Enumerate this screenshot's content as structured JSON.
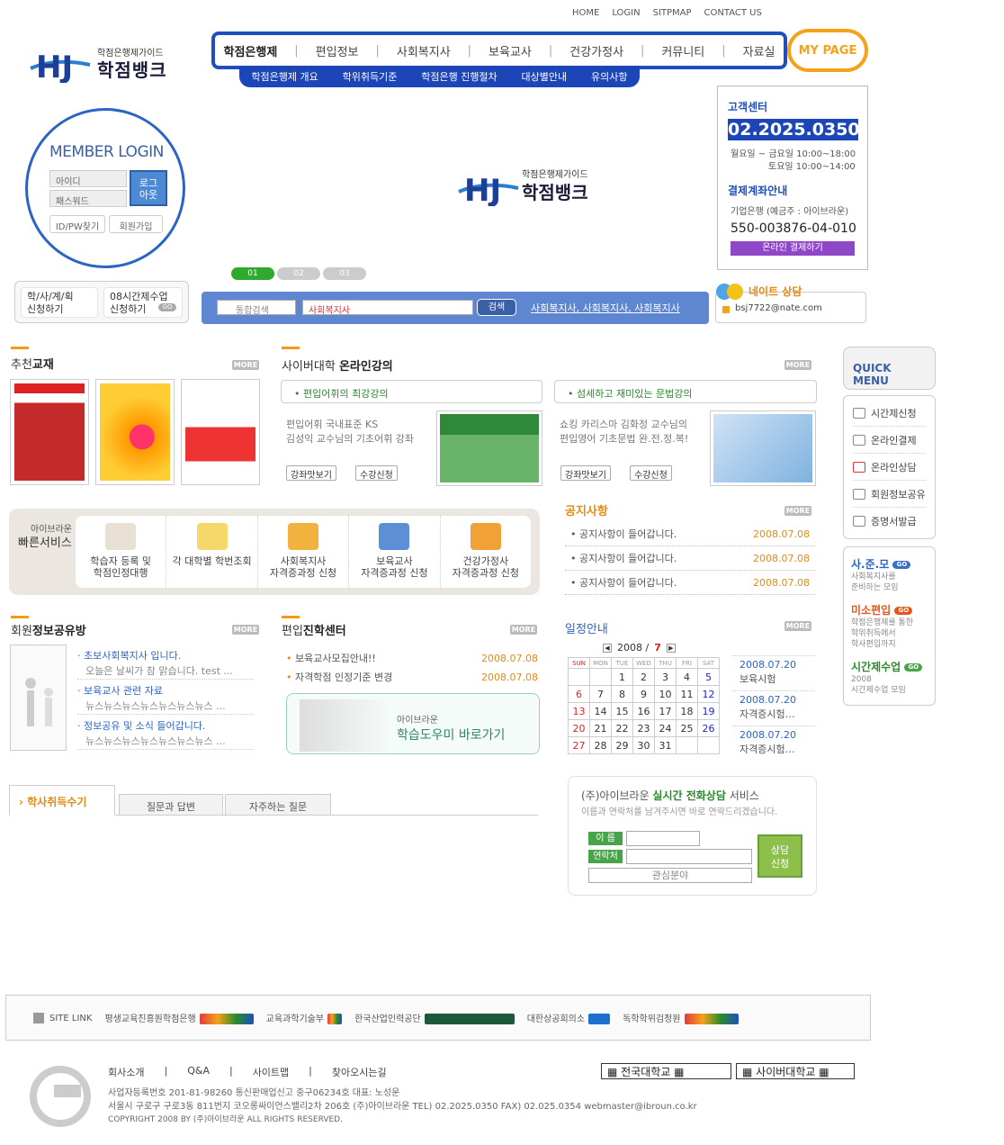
{
  "topnav": [
    "HOME",
    "LOGIN",
    "SITPMAP",
    "CONTACT US"
  ],
  "logo": {
    "sub": "학점은행제가이드",
    "name": "학점뱅크"
  },
  "gnb": [
    "학점은행제",
    "편입정보",
    "사회복지사",
    "보육교사",
    "건강가정사",
    "커뮤니티",
    "자료실"
  ],
  "subnav": [
    "학점은행제 개요",
    "학위취득기준",
    "학점은행 진행절차",
    "대상별안내",
    "유의사항"
  ],
  "mypage": "MY PAGE",
  "login": {
    "title": "MEMBER LOGIN",
    "id_ph": "아이디",
    "pw_ph": "패스워드",
    "btn": "로그\n아웃",
    "find": "ID/PW찾기",
    "join": "회원가입"
  },
  "cs": {
    "title": "고객센터",
    "phone": "02.2025.0350",
    "hours1": "월요일 ~ 금요일 10:00~18:00",
    "hours2": "토요일 10:00~14:00",
    "acct_title": "결제계좌안내",
    "bank": "기업은행 (예금주 : 아이브라운)",
    "acct": "550-003876-04-010",
    "pay": "온라인 결제하기"
  },
  "tabs": [
    "01",
    "02",
    "03"
  ],
  "quick": {
    "a": "학/사/계/획\n신청하기",
    "b": "08시간제수업\n신청하기",
    "go": "GO"
  },
  "search": {
    "select": "통합검색",
    "value": "사회복지사",
    "btn": "검색",
    "keywords": "사회복지사, 사회복지사, 사회복지사"
  },
  "nate": {
    "label": "네이트 상담",
    "mail": "bsj7722@nate.com"
  },
  "books": {
    "title_pre": "추천",
    "title": "교재",
    "more": "MORE"
  },
  "cyber": {
    "title_pre": "사이버대학 ",
    "title": "온라인강의",
    "more": "MORE",
    "l1": {
      "head": "편입어휘의 최강강의",
      "t1": "편입어휘 국내표준 KS",
      "t2": "김성익 교수님의 기초어휘 강좌"
    },
    "l2": {
      "head": "섬세하고 재미있는 문법강의",
      "t1": "쇼킹 카리스마 김화정 교수님의",
      "t2": "편입영어 기초문법 완.전.정.복!"
    },
    "btn1": "강좌맛보기",
    "btn2": "수강신청"
  },
  "fast": {
    "label1": "아이브라운",
    "label2": "빠른서비스",
    "items": [
      "학습자 등록 및\n학점인정대행",
      "각 대학별 학번조회",
      "사회복지사\n자격증과정 신청",
      "보육교사\n자격증과정 신청",
      "건강가정사\n자격증과정 신청"
    ]
  },
  "notice": {
    "title": "공지사항",
    "more": "MORE",
    "items": [
      {
        "t": "공지사항이 들어갑니다.",
        "d": "2008.07.08"
      },
      {
        "t": "공지사항이 들어갑니다.",
        "d": "2008.07.08"
      },
      {
        "t": "공지사항이 들어갑니다.",
        "d": "2008.07.08"
      }
    ]
  },
  "share": {
    "title_pre": "회원",
    "title": "정보공유방",
    "more": "MORE",
    "items": [
      {
        "t": "초보사회복지사 입니다.",
        "s": "오늘은 날씨가 참 맑습니다. test ..."
      },
      {
        "t": "보육교사 관련 자료",
        "s": "뉴스뉴스뉴스뉴스뉴스뉴스뉴스 ..."
      },
      {
        "t": "정보공유 및 소식 들어갑니다.",
        "s": "뉴스뉴스뉴스뉴스뉴스뉴스뉴스 ..."
      }
    ]
  },
  "transfer": {
    "title_pre": "편입",
    "title": "진학센터",
    "more": "MORE",
    "items": [
      {
        "t": "보육교사모집안내!!",
        "d": "2008.07.08"
      },
      {
        "t": "자격학점 인정기준 변경",
        "d": "2008.07.08"
      }
    ],
    "banner_sub": "아이브라운",
    "banner": "학습도우미 바로가기"
  },
  "schedule": {
    "title": "일정안내",
    "more": "MORE",
    "year": "2008 /",
    "month": "7",
    "days": [
      "SUN",
      "MON",
      "TUE",
      "WED",
      "THU",
      "FRI",
      "SAT"
    ],
    "weeks": [
      [
        "",
        "",
        "1",
        "2",
        "3",
        "4",
        "5"
      ],
      [
        "6",
        "7",
        "8",
        "9",
        "10",
        "11",
        "12"
      ],
      [
        "13",
        "14",
        "15",
        "16",
        "17",
        "18",
        "19"
      ],
      [
        "20",
        "21",
        "22",
        "23",
        "24",
        "25",
        "26"
      ],
      [
        "27",
        "28",
        "29",
        "30",
        "31",
        "",
        ""
      ]
    ],
    "events": [
      {
        "d": "2008.07.20",
        "t": "보육시험"
      },
      {
        "d": "2008.07.20",
        "t": "자격증시험…"
      },
      {
        "d": "2008.07.20",
        "t": "자격증시험…"
      }
    ]
  },
  "review": {
    "tab1": "학사취득수기",
    "tab2": "질문과 답변",
    "tab3": "자주하는 질문"
  },
  "call": {
    "pre": "(주)아이브라운 ",
    "hl": "실시간 전화상담",
    "post": " 서비스",
    "desc": "이름과 연락처를 남겨주시면 바로 연락드리겠습니다.",
    "name": "이 름",
    "contact": "연락처",
    "field": "관심분야",
    "btn": "상담\n신청"
  },
  "quickmenu": {
    "title": "QUICK MENU",
    "items": [
      "시간제신청",
      "온라인결제",
      "온라인상담",
      "회원정보공유",
      "증명서발급"
    ],
    "g1": {
      "t": "사.준.모",
      "s": "사회복지사를\n준비하는 모임"
    },
    "g2": {
      "t": "미소편입",
      "s": "학점은행제를 통한\n학위취득에서\n학사편입까지"
    },
    "g3": {
      "t": "시간제수업",
      "s": "2008\n시간제수업 모임"
    },
    "go": "GO"
  },
  "sitelink": {
    "label": "SITE LINK",
    "items": [
      "평생교육진흥원학점은행",
      "교육과학기술부",
      "한국산업인력공단",
      "대한상공회의소",
      "독학학위검정원"
    ]
  },
  "footer": {
    "menu": [
      "회사소개",
      "|",
      "Q&A",
      "|",
      "사이트맵",
      "|",
      "찾아오시는길"
    ],
    "l1": "사업자등록번호  201-81-98260   통신판매업신고 중구06234호   대표: 노성운",
    "l2": "서울시 구로구 구로3동 811번지 코오롱싸이언스밸리2차 206호 (주)아이브라운   TEL) 02.2025.0350   FAX) 02.025.0354     webmaster@ibroun.co.kr",
    "l3": "COPYRIGHT 2008 BY (주)아이브라운 ALL RIGHTS RESERVED.",
    "sel1": "▦ 전국대학교 ▦",
    "sel2": "▦ 사이버대학교 ▦"
  }
}
